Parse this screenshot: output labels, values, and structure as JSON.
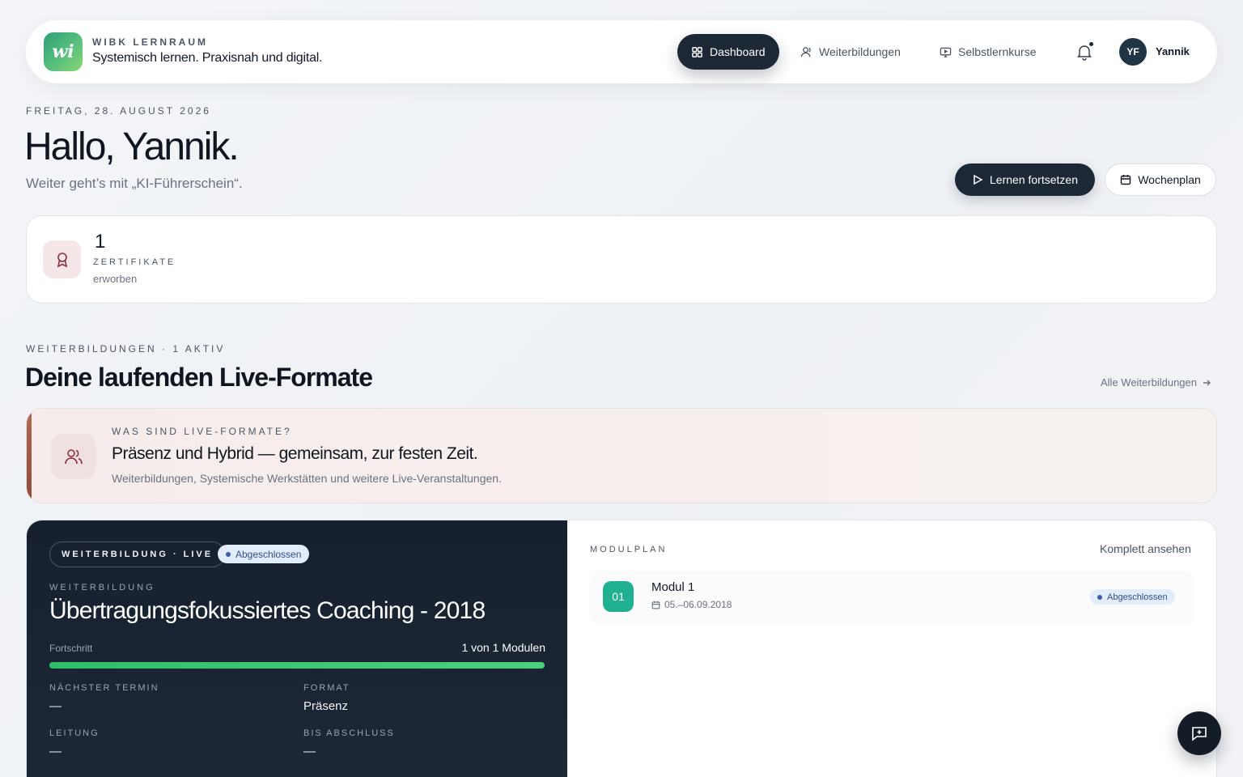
{
  "header": {
    "brand_eyebrow": "WIBK LERNRAUM",
    "brand_title": "Systemisch lernen. Praxisnah und digital.",
    "logo_text": "wi",
    "nav": [
      {
        "label": "Dashboard",
        "icon": "grid-icon",
        "active": true
      },
      {
        "label": "Weiterbildungen",
        "icon": "user-icon",
        "active": false
      },
      {
        "label": "Selbstlernkurse",
        "icon": "monitor-icon",
        "active": false
      }
    ],
    "user_initials": "YF",
    "user_name": "Yannik"
  },
  "hero": {
    "date": "FREITAG, 28. AUGUST 2026",
    "greeting": "Hallo, Yannik.",
    "subtitle": "Weiter geht’s mit „KI-Führerschein“.",
    "primary_action": "Lernen fortsetzen",
    "secondary_action": "Wochenplan"
  },
  "certificates": {
    "count": "1",
    "label": "ZERTIFIKATE",
    "sub": "erworben"
  },
  "section": {
    "eyebrow": "WEITERBILDUNGEN · 1 AKTIV",
    "title": "Deine laufenden Live-Formate",
    "link": "Alle Weiterbildungen"
  },
  "info": {
    "eyebrow": "WAS SIND LIVE-FORMATE?",
    "title": "Präsenz und Hybrid — gemeinsam, zur festen Zeit.",
    "description": "Weiterbildungen, Systemische Werkstätten und weitere Live-Veranstaltungen."
  },
  "course": {
    "type_pill": "WEITERBILDUNG · LIVE",
    "status": "Abgeschlossen",
    "eyebrow": "WEITERBILDUNG",
    "title": "Übertragungsfokussiertes Coaching - 2018",
    "progress_label": "Fortschritt",
    "progress_text": "1 von 1 Modulen",
    "progress_fraction": 1.0,
    "meta": {
      "next_label": "NÄCHSTER TERMIN",
      "next_value": "—",
      "format_label": "FORMAT",
      "format_value": "Präsenz",
      "lead_label": "LEITUNG",
      "lead_value": "—",
      "end_label": "BIS ABSCHLUSS",
      "end_value": "—"
    }
  },
  "modulplan": {
    "eyebrow": "MODULPLAN",
    "link": "Komplett ansehen",
    "modules": [
      {
        "number": "01",
        "title": "Modul 1",
        "date": "05.–06.09.2018",
        "status": "Abgeschlossen"
      }
    ]
  },
  "colors": {
    "dark": "#1c2836",
    "accent_green": "#2fbf6c",
    "module_teal": "#1fb191",
    "status_bg": "#e3ecfb",
    "status_text": "#2f4e8e"
  }
}
